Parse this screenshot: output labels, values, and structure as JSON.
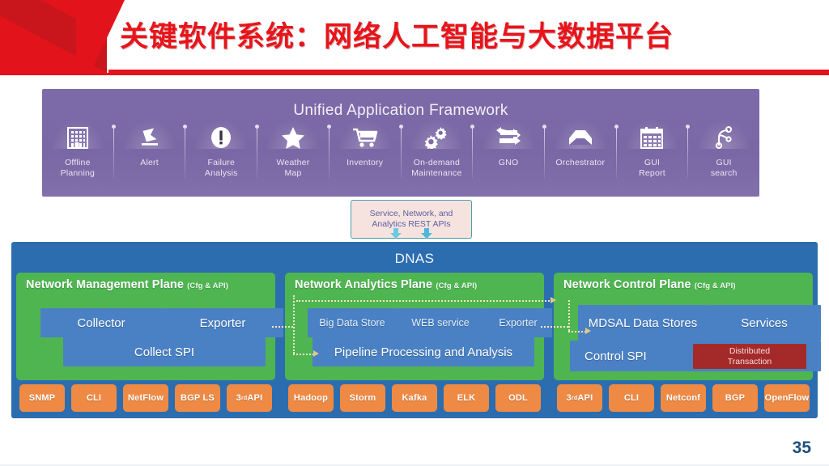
{
  "slide": {
    "title": "关键软件系统：网络人工智能与大数据平台",
    "page_number": "35",
    "accent_red": "#e3131b",
    "purple": "#7b68a8",
    "blue": "#2c6db0",
    "green": "#4fb551",
    "orange": "#ef8a44",
    "inner_blue": "#4a81c4",
    "dark_red": "#a42a2a"
  },
  "unified_framework": {
    "title": "Unified Application Framework",
    "items": [
      {
        "label": "Offline\nPlanning",
        "label_line1": "Offline",
        "label_line2": "Planning",
        "icon": "building-icon"
      },
      {
        "label": "Alert",
        "label_line1": "Alert",
        "label_line2": "",
        "icon": "flag-icon"
      },
      {
        "label": "Failure\nAnalysis",
        "label_line1": "Failure",
        "label_line2": "Analysis",
        "icon": "exclamation-circle-icon"
      },
      {
        "label": "Weather\nMap",
        "label_line1": "Weather",
        "label_line2": "Map",
        "icon": "star-icon"
      },
      {
        "label": "Inventory",
        "label_line1": "Inventory",
        "label_line2": "",
        "icon": "shopping-cart-icon"
      },
      {
        "label": "On-demand\nMaintenance",
        "label_line1": "On-demand",
        "label_line2": "Maintenance",
        "icon": "gears-icon"
      },
      {
        "label": "GNO",
        "label_line1": "GNO",
        "label_line2": "",
        "icon": "sync-arrows-icon"
      },
      {
        "label": "Orchestrator",
        "label_line1": "Orchestrator",
        "label_line2": "",
        "icon": "inbox-tray-icon"
      },
      {
        "label": "GUI\nReport",
        "label_line1": "GUI",
        "label_line2": "Report",
        "icon": "calendar-icon"
      },
      {
        "label": "GUI\nsearch",
        "label_line1": "GUI",
        "label_line2": "search",
        "icon": "node-graph-icon"
      }
    ]
  },
  "rest_api": {
    "line1": "Service, Network, and",
    "line2": "Analytics REST APIs"
  },
  "dnas": {
    "title": "DNAS",
    "planes": [
      {
        "title": "Network Management Plane",
        "title_suffix": "(Cfg & API)",
        "blocks_top": [
          {
            "label": "Collector"
          },
          {
            "label": "Exporter"
          }
        ],
        "block_bottom": {
          "label": "Collect SPI"
        },
        "tags": [
          {
            "label": "SNMP",
            "sup": ""
          },
          {
            "label": "CLI",
            "sup": ""
          },
          {
            "label": "NetFlow",
            "sup": ""
          },
          {
            "label": "BGP LS",
            "sup": ""
          },
          {
            "label": "3",
            "sup": "rd",
            "label_tail": " API"
          }
        ]
      },
      {
        "title": "Network Analytics Plane",
        "title_suffix": "(Cfg & API)",
        "blocks_top": [
          {
            "label": "Big Data Store"
          },
          {
            "label": "WEB service"
          },
          {
            "label": "Exporter"
          }
        ],
        "block_bottom": {
          "label": "Pipeline Processing and Analysis"
        },
        "tags": [
          {
            "label": "Hadoop",
            "sup": ""
          },
          {
            "label": "Storm",
            "sup": ""
          },
          {
            "label": "Kafka",
            "sup": ""
          },
          {
            "label": "ELK",
            "sup": ""
          },
          {
            "label": "ODL",
            "sup": ""
          }
        ]
      },
      {
        "title": "Network Control Plane",
        "title_suffix": "(Cfg & API)",
        "blocks_top": [
          {
            "label": "MDSAL Data Stores"
          },
          {
            "label": "Services"
          }
        ],
        "block_bottom": {
          "label": "Control SPI"
        },
        "block_extra": {
          "label": "Distributed Transaction",
          "line1": "Distributed",
          "line2": "Transaction"
        },
        "tags": [
          {
            "label": "3",
            "sup": "rd",
            "label_tail": " API"
          },
          {
            "label": "CLI",
            "sup": ""
          },
          {
            "label": "Netconf",
            "sup": ""
          },
          {
            "label": "BGP",
            "sup": ""
          },
          {
            "label": "OpenFlow",
            "sup": ""
          }
        ]
      }
    ]
  }
}
